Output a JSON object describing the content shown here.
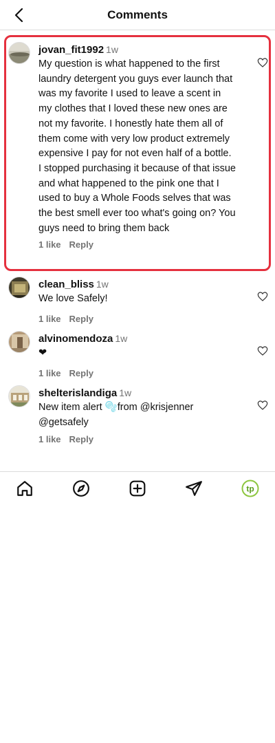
{
  "header": {
    "title": "Comments"
  },
  "comments": [
    {
      "username": "jovan_fit1992",
      "time": "1w",
      "text": "My question is what happened to the first laundry detergent you guys ever launch that was my favorite I used to leave a scent in my clothes that I loved these new ones are not my favorite. I honestly hate them all of them come with very low product extremely expensive I pay for not even half of a bottle. I stopped purchasing it because of that issue and what happened to the pink one that I used to buy a Whole Foods selves that was the best smell ever too what's going on? You guys need to bring them back",
      "likes": "1 like",
      "reply": "Reply"
    },
    {
      "username": "clean_bliss",
      "time": "1w",
      "text": "We love Safely!",
      "likes": "1 like",
      "reply": "Reply"
    },
    {
      "username": "alvinomendoza",
      "time": "1w",
      "text": "❤",
      "likes": "1 like",
      "reply": "Reply"
    },
    {
      "username": "shelterislandiga",
      "time": "1w",
      "text": "New item alert 🫧from @krisjenner @getsafely",
      "likes": "1 like",
      "reply": "Reply"
    }
  ],
  "bottom_nav": {
    "items": [
      "home-icon",
      "explore-icon",
      "create-icon",
      "messages-icon",
      "profile-avatar"
    ],
    "profile_initials": "tp",
    "accent": "#8dc63f"
  },
  "colors": {
    "highlight": "#e5303e",
    "muted": "#737373",
    "divider": "#dbdbdb"
  }
}
